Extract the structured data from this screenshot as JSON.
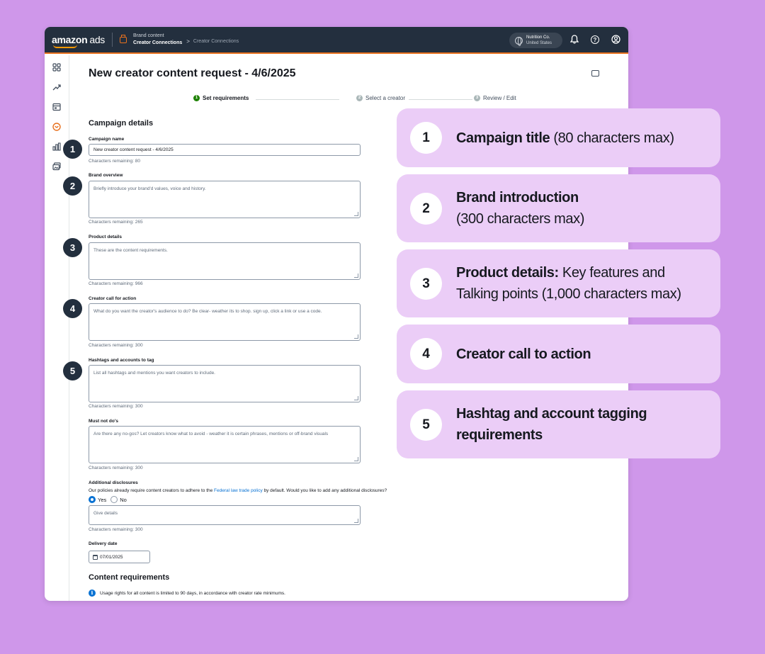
{
  "topbar": {
    "logo_main": "amazon",
    "logo_ads": "ads",
    "breadcrumb_top": "Brand content",
    "breadcrumb_main": "Creator Connections",
    "breadcrumb_arrow": ">",
    "breadcrumb_current": "Creator Connections",
    "account_name": "Nutrition Co.",
    "account_country": "United States",
    "bell_icon": "bell-icon",
    "help_label": "?",
    "profile_icon": "user-circle-icon"
  },
  "leftnav": {
    "items": [
      "dashboard-icon",
      "trend-icon",
      "browser-icon",
      "creator-connections-icon",
      "bar-chart-icon",
      "media-icon"
    ],
    "active_index": 3
  },
  "page": {
    "title": "New creator content request - 4/6/2025",
    "feedback_icon": "feedback-icon"
  },
  "stepper": {
    "steps": [
      {
        "num": "1",
        "label": "Set requirements",
        "state": "active"
      },
      {
        "num": "2",
        "label": "Select a creator",
        "state": "inactive"
      },
      {
        "num": "3",
        "label": "Review / Edit",
        "state": "inactive"
      }
    ]
  },
  "form": {
    "section_title": "Campaign details",
    "campaign_name": {
      "label": "Campaign name",
      "value": "New creator content request - 4/6/2025",
      "hint": "Characters remaining: 80"
    },
    "brand_overview": {
      "label": "Brand overview",
      "placeholder": "Briefly introduce your brand'd values, voice and history.",
      "hint": "Characters remaining: 265"
    },
    "product_details": {
      "label": "Product details",
      "placeholder": "These are the content requirements.",
      "hint": "Characters remaining: 966"
    },
    "call_for_action": {
      "label": "Creator call for action",
      "placeholder": "What do you want the creator's audience to do? Be clear- weather its to shop. sign up, click a link or use a code.",
      "hint": "Characters remaining: 300"
    },
    "hashtags": {
      "label": "Hashtags and accounts to tag",
      "placeholder": "List all hashtags and mentions you want creators to include.",
      "hint": "Characters remaining: 300"
    },
    "must_not": {
      "label": "Must not do's",
      "placeholder": "Are there any no-gos? Let creators know what to avoid - weather it is certain phrases, mentions or off-brand visuals",
      "hint": "Characters remaining: 300"
    },
    "disclosures": {
      "label": "Additional disclosures",
      "text_before": "Our policies already require content creators to adhere to the ",
      "link": "Federal law trade policy",
      "text_after": " by default. Would you like to add any additional disclosures?",
      "yes_label": "Yes",
      "no_label": "No",
      "selected": "Yes",
      "placeholder": "Give details",
      "hint": "Characters remaining: 300"
    },
    "delivery_date": {
      "label": "Delivery date",
      "value": "07/01/2025"
    },
    "content_section_title": "Content requirements",
    "usage_info": "Usage rights for all content is limited to 90 days, in accordance with creator rate minimums."
  },
  "badges": [
    "1",
    "2",
    "3",
    "4",
    "5"
  ],
  "callouts": [
    {
      "num": "1",
      "bold": "Campaign title",
      "rest": " (80 characters max)"
    },
    {
      "num": "2",
      "bold": "Brand introduction",
      "rest": "(300 characters max)"
    },
    {
      "num": "3",
      "bold": "Product details:",
      "rest": " Key features and",
      "line2": "Talking points (1,000 characters max)"
    },
    {
      "num": "4",
      "bold": "Creator call to action",
      "rest": ""
    },
    {
      "num": "5",
      "bold": "Hashtag and account tagging",
      "line2_bold": "requirements"
    }
  ],
  "colors": {
    "background": "#cf97ea",
    "callout_bg": "#ebcdf7",
    "topbar": "#232f3e",
    "accent_orange": "#e8711e",
    "link_blue": "#0972d3",
    "step_active_green": "#1d8102"
  }
}
